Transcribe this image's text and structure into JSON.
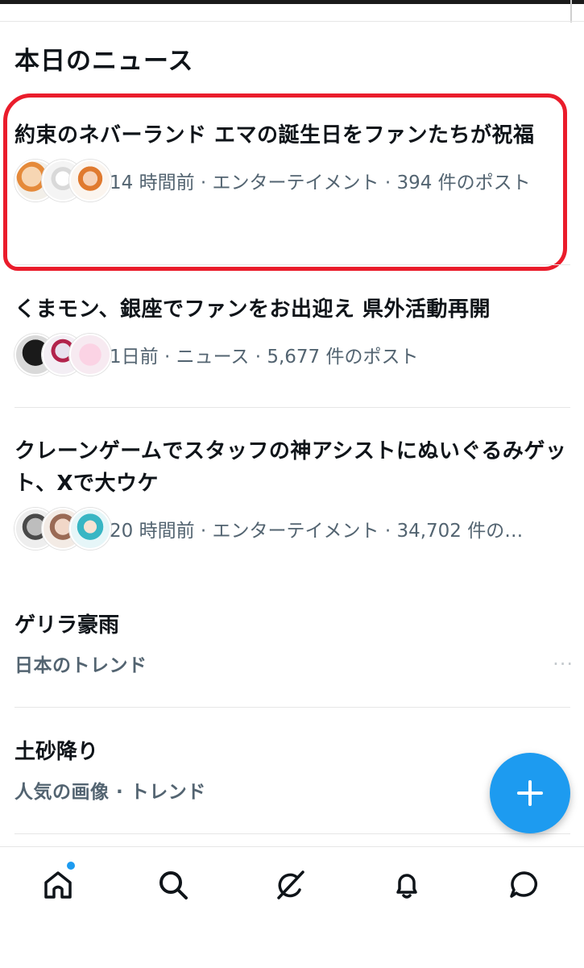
{
  "section": {
    "title": "本日のニュース"
  },
  "news": [
    {
      "title": "約束のネバーランド エマの誕生日をファンたちが祝福",
      "meta": "14 時間前 · エンターテイメント · 394 件のポスト"
    },
    {
      "title": "くまモン、銀座でファンをお出迎え 県外活動再開",
      "meta": "1日前 · ニュース · 5,677 件のポスト"
    },
    {
      "title": "クレーンゲームでスタッフの神アシストにぬいぐるみゲット、Xで大ウケ",
      "meta": "20 時間前 · エンターテイメント · 34,702 件の…"
    }
  ],
  "trends": [
    {
      "title": "ゲリラ豪雨",
      "subtitle": "日本のトレンド",
      "more": "···"
    },
    {
      "title": "土砂降り",
      "subtitle": "人気の画像 · トレンド"
    }
  ],
  "nav": {
    "items": [
      {
        "icon": "home-icon",
        "has_notification_dot": true
      },
      {
        "icon": "search-icon"
      },
      {
        "icon": "grok-icon"
      },
      {
        "icon": "bell-icon"
      },
      {
        "icon": "messages-icon"
      }
    ]
  },
  "fab": {
    "icon": "plus-icon"
  },
  "colors": {
    "accent": "#1d9bf0",
    "highlight": "#ea1c2b",
    "secondary_text": "#536471"
  }
}
